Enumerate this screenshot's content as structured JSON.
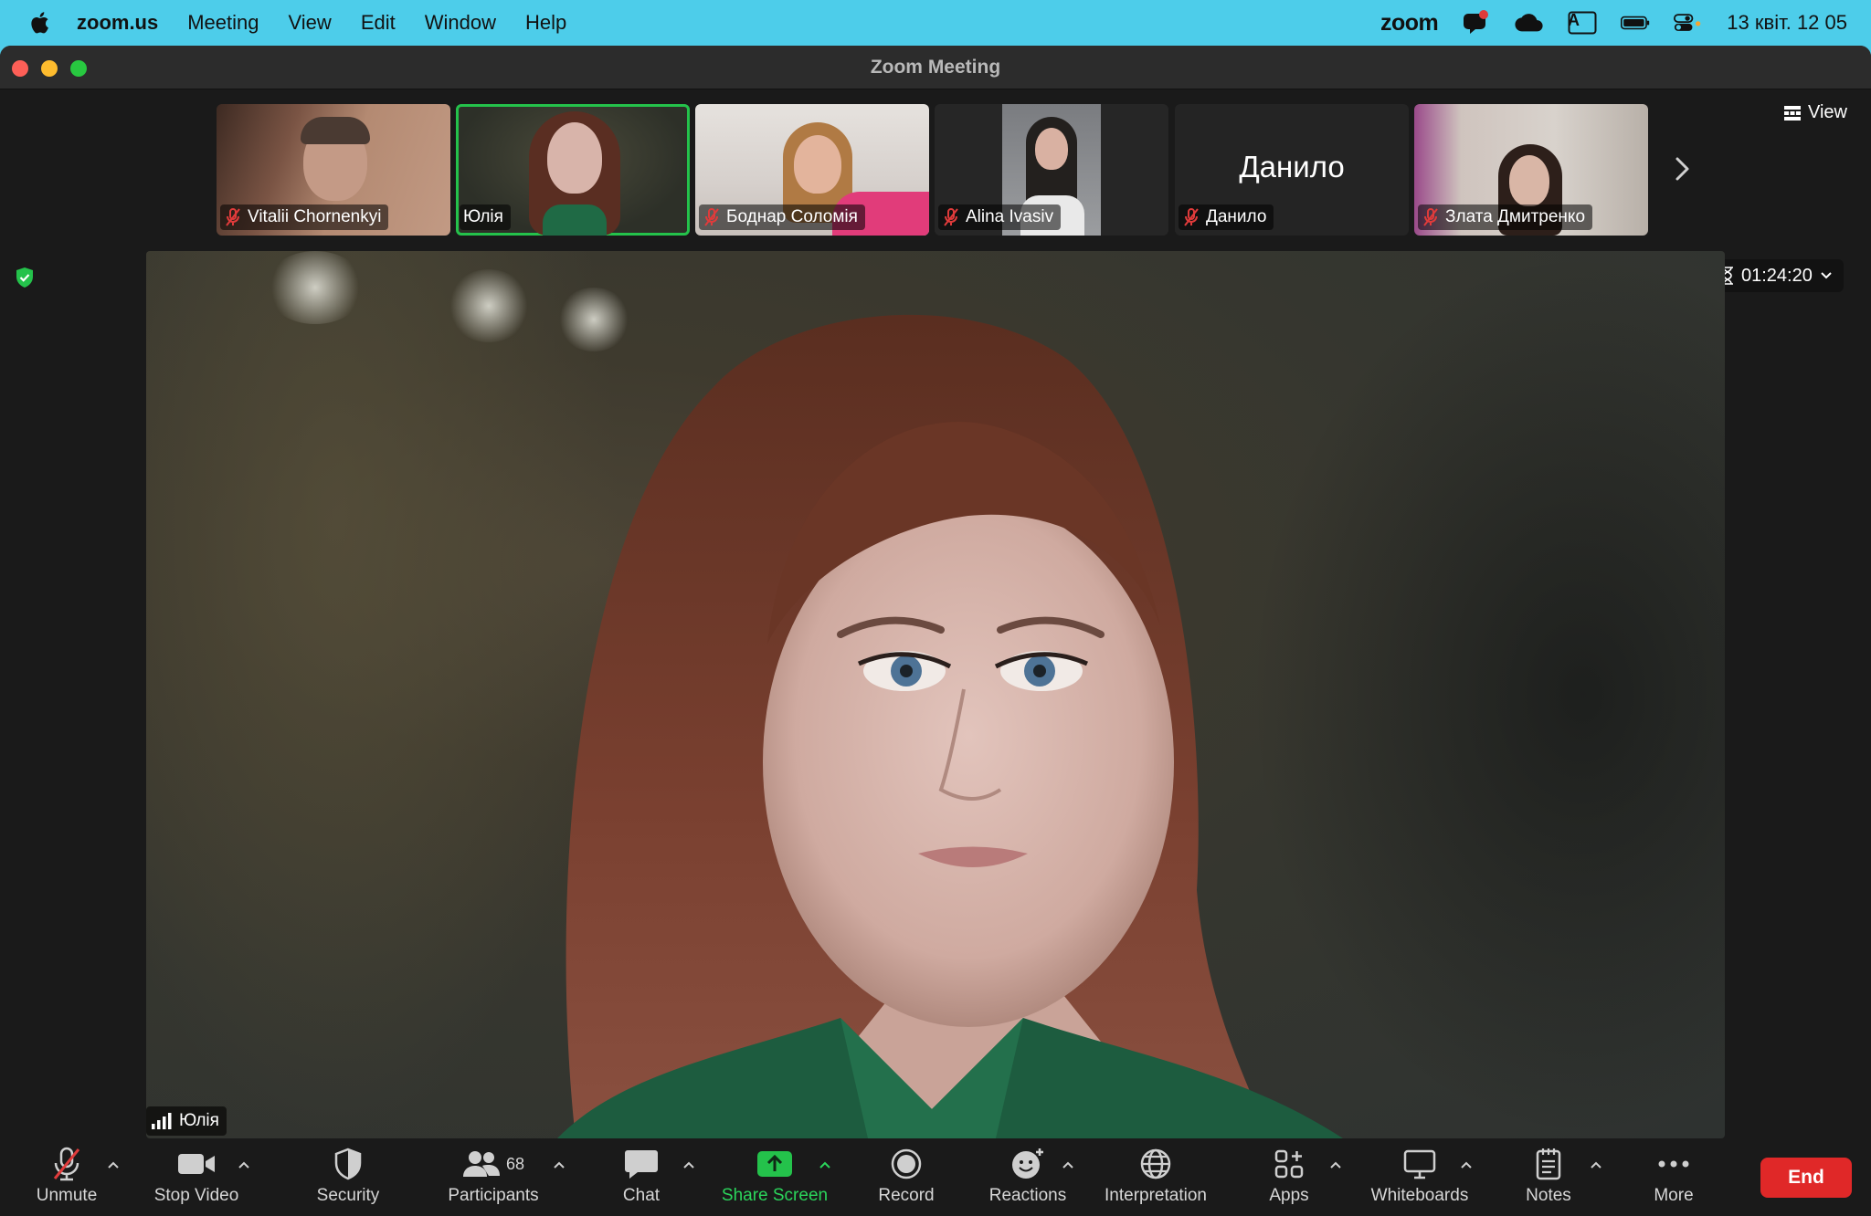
{
  "menubar": {
    "app_name": "zoom.us",
    "menus": [
      "Meeting",
      "View",
      "Edit",
      "Window",
      "Help"
    ],
    "zoom_logo": "zoom",
    "keyboard_indicator": "A",
    "clock": "13 квіт.  12 05"
  },
  "window": {
    "title": "Zoom Meeting"
  },
  "thumbnails": [
    {
      "name": "Vitalii Chornenkyi",
      "muted": true,
      "active": false
    },
    {
      "name": "Юлія",
      "muted": false,
      "active": true
    },
    {
      "name": "Боднар Соломія",
      "muted": true,
      "active": false
    },
    {
      "name": "Alina Ivasiv",
      "muted": true,
      "active": false
    },
    {
      "name": "Данило",
      "muted": true,
      "active": false,
      "video_off": true,
      "display_name": "Данило"
    },
    {
      "name": "Злата Дмитренко",
      "muted": true,
      "active": false
    }
  ],
  "view_button": {
    "label": "View"
  },
  "speaker": {
    "name": "Юлія"
  },
  "timer": {
    "value": "01:24:20"
  },
  "toolbar": {
    "unmute": "Unmute",
    "stop_video": "Stop Video",
    "security": "Security",
    "participants": "Participants",
    "participants_count": "68",
    "chat": "Chat",
    "share_screen": "Share Screen",
    "record": "Record",
    "reactions": "Reactions",
    "interpretation": "Interpretation",
    "apps": "Apps",
    "whiteboards": "Whiteboards",
    "notes": "Notes",
    "more": "More",
    "end": "End"
  },
  "colors": {
    "accent_green": "#24c24b",
    "end_red": "#e02828",
    "menubar": "#4dcdea",
    "mute_red": "#e03b3b"
  }
}
